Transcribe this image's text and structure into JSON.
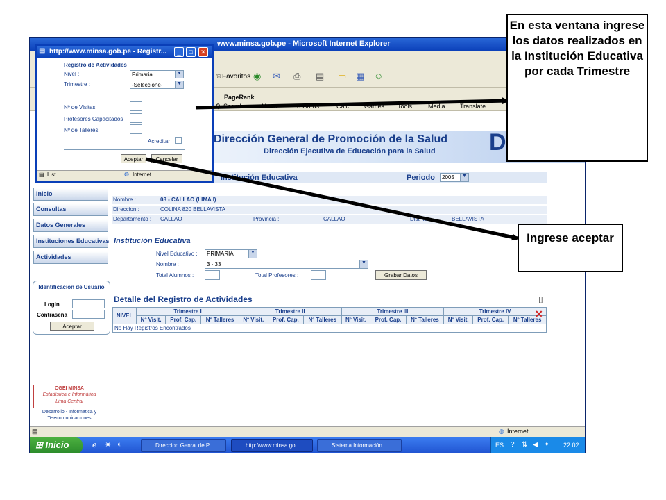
{
  "ie": {
    "title": "www.minsa.gob.pe - Microsoft Internet Explorer",
    "toolbar": {
      "favorites": "Favoritos"
    },
    "links": {
      "pagerank": "PageRank",
      "search": "Search",
      "news": "News",
      "ecards": "e-Cards",
      "calc": "Calc",
      "games": "Games",
      "tools": "Tools",
      "media": "Media",
      "translate": "Translate"
    },
    "status": "Internet"
  },
  "taskbar": {
    "start": "Inicio",
    "tasks": [
      "Direccion Genral de P...",
      "http://www.minsa.go...",
      "Sistema Información ..."
    ],
    "lang": "ES",
    "clock": "22:02"
  },
  "banner": {
    "title": "Dirección General de Promoción de la Salud",
    "subtitle": "Dirección Ejecutiva de Educación para la Salud",
    "logo_letter": "D"
  },
  "section": {
    "label": "Institución Educativa",
    "periodo_label": "Periodo",
    "periodo_value": "2005"
  },
  "nav": [
    "Inicio",
    "Consultas",
    "Datos Generales",
    "Instituciones Educativas",
    "Actividades"
  ],
  "info": {
    "nombre_label": "Nombre :",
    "nombre_value": "08 - CALLAO (LIMA I)",
    "direccion_label": "Direccion :",
    "direccion_value": "COLINA 820 BELLAVISTA",
    "departamento_label": "Departamento :",
    "departamento_value": "CALLAO",
    "provincia_label": "Provincia :",
    "provincia_value": "CALLAO",
    "distrito_label": "Distrito :",
    "distrito_value": "BELLAVISTA"
  },
  "institucion": {
    "heading": "Institución Educativa",
    "nivel_label": "Nivel Educativo :",
    "nivel_value": "PRIMARIA",
    "nombre_label": "Nombre :",
    "nombre_value": "3 - 33",
    "alumnos_label": "Total Alumnos :",
    "profesores_label": "Total Profesores :",
    "grabar": "Grabar Datos"
  },
  "detail": {
    "title": "Detalle del Registro de Actividades",
    "nivel": "NIVEL",
    "trimestres": [
      "Trimestre I",
      "Trimestre II",
      "Trimestre III",
      "Trimestre IV"
    ],
    "cols": [
      "Nº Visit.",
      "Prof. Cap.",
      "Nº Talleres"
    ],
    "empty": "No Hay Registros Encontrados"
  },
  "login": {
    "title": "Identificación de Usuario",
    "login_label": "Login",
    "password_label": "Contraseña",
    "button": "Aceptar"
  },
  "footer": {
    "logo_top": "OGEI MINSA",
    "logo_mid": "Estadística e Informática",
    "logo_sub": "Lima Central",
    "credit": "Desarrollo - Informatica y Telecomunicaciones"
  },
  "popup": {
    "title": "http://www.minsa.gob.pe - Registr...",
    "heading": "Registro de Actividades",
    "nivel_label": "Nivel :",
    "nivel_value": "Primaria",
    "trimestre_label": "Trimestre :",
    "trimestre_value": "-Seleccione-",
    "visitas_label": "Nº de Visitas",
    "profesores_label": "Profesores Capacitados",
    "talleres_label": "Nº de Talleres",
    "acreditar_label": "Acreditar",
    "aceptar": "Aceptar",
    "cancelar": "Cancelar",
    "status_left": "List",
    "status_right": "Internet"
  },
  "callouts": {
    "top": "En esta ventana ingrese los datos realizados en la Institución Educativa por cada Trimestre",
    "bottom": "Ingrese aceptar"
  }
}
